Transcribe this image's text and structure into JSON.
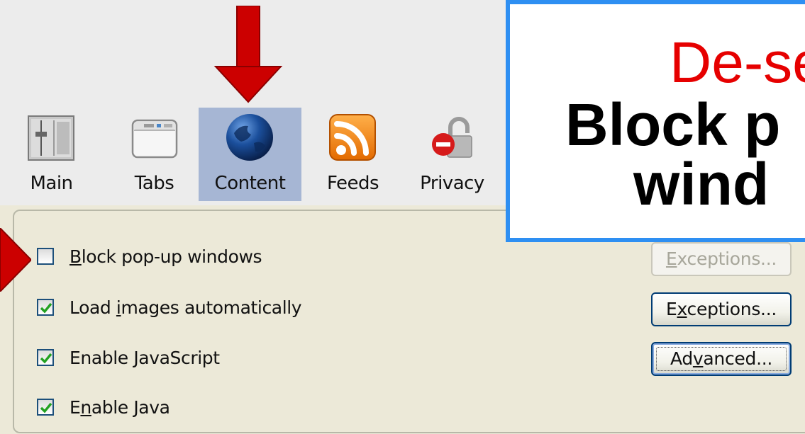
{
  "tabs": [
    {
      "label": "Main",
      "icon": "main-sliders-icon"
    },
    {
      "label": "Tabs",
      "icon": "tabs-window-icon"
    },
    {
      "label": "Content",
      "icon": "globe-icon",
      "active": true
    },
    {
      "label": "Feeds",
      "icon": "rss-feed-icon"
    },
    {
      "label": "Privacy",
      "icon": "privacy-lock-icon"
    }
  ],
  "content": {
    "rows": [
      {
        "pre": "",
        "key": "B",
        "post": "lock pop-up windows",
        "checked": false
      },
      {
        "pre": "Load ",
        "key": "i",
        "post": "mages automatically",
        "checked": true
      },
      {
        "pre": "Enable ",
        "key": "J",
        "post": "avaScript",
        "checked": true
      },
      {
        "pre": "E",
        "key": "n",
        "post": "able Java",
        "checked": true
      }
    ],
    "buttons": {
      "exceptions_popup": {
        "pre": "",
        "key": "E",
        "post": "xceptions...",
        "enabled": false
      },
      "exceptions_images": {
        "pre": "E",
        "key": "x",
        "post": "ceptions...",
        "enabled": true
      },
      "advanced": {
        "pre": "Ad",
        "key": "v",
        "post": "anced...",
        "enabled": true
      }
    }
  },
  "callout": {
    "line1": "De-se",
    "line2": "Block p",
    "line3": "wind"
  },
  "colors": {
    "active_tab": "#a6b6d4",
    "arrow": "#cc0000",
    "callout_border": "#2e8ff2",
    "callout_accent": "#e60000",
    "check": "#21a121"
  }
}
